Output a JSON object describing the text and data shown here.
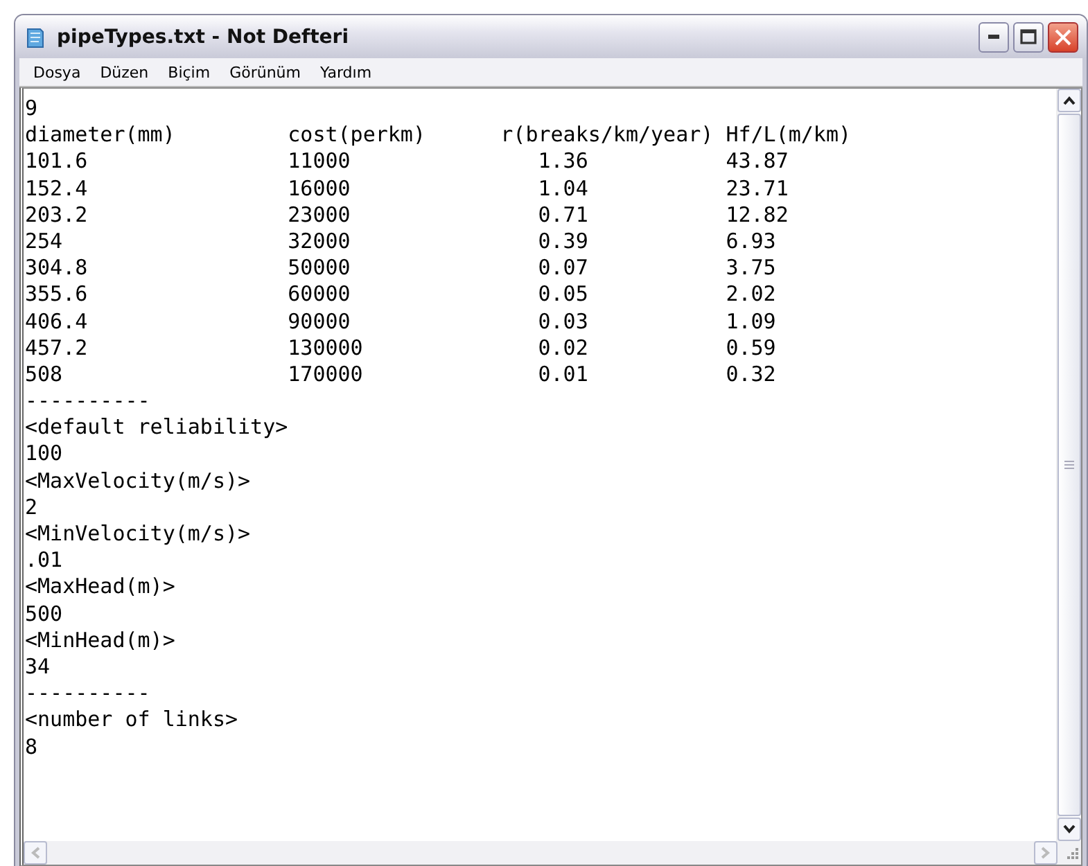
{
  "window": {
    "title": "pipeTypes.txt - Not Defteri"
  },
  "menu": [
    "Dosya",
    "Düzen",
    "Biçim",
    "Görünüm",
    "Yardım"
  ],
  "document": [
    {
      "kind": "text",
      "text": "9"
    },
    {
      "kind": "header",
      "cells": [
        "diameter(mm)",
        "cost(perkm)",
        "r(breaks/km/year)",
        "Hf/L(m/km)"
      ]
    },
    {
      "kind": "row",
      "cells": [
        "101.6",
        "11000",
        "1.36",
        "43.87"
      ]
    },
    {
      "kind": "row",
      "cells": [
        "152.4",
        "16000",
        "1.04",
        "23.71"
      ]
    },
    {
      "kind": "row",
      "cells": [
        "203.2",
        "23000",
        "0.71",
        "12.82"
      ]
    },
    {
      "kind": "row",
      "cells": [
        "254",
        "32000",
        "0.39",
        "6.93"
      ]
    },
    {
      "kind": "row",
      "cells": [
        "304.8",
        "50000",
        "0.07",
        "3.75"
      ]
    },
    {
      "kind": "row",
      "cells": [
        "355.6",
        "60000",
        "0.05",
        "2.02"
      ]
    },
    {
      "kind": "row",
      "cells": [
        "406.4",
        "90000",
        "0.03",
        "1.09"
      ]
    },
    {
      "kind": "row",
      "cells": [
        "457.2",
        "130000",
        "0.02",
        "0.59"
      ]
    },
    {
      "kind": "row",
      "cells": [
        "508",
        "170000",
        "0.01",
        "0.32"
      ]
    },
    {
      "kind": "text",
      "text": "----------"
    },
    {
      "kind": "text",
      "text": "<default reliability>"
    },
    {
      "kind": "text",
      "text": "100"
    },
    {
      "kind": "text",
      "text": "<MaxVelocity(m/s)>"
    },
    {
      "kind": "text",
      "text": "2"
    },
    {
      "kind": "text",
      "text": "<MinVelocity(m/s)>"
    },
    {
      "kind": "text",
      "text": ".01"
    },
    {
      "kind": "text",
      "text": "<MaxHead(m)>"
    },
    {
      "kind": "text",
      "text": "500"
    },
    {
      "kind": "text",
      "text": "<MinHead(m)>"
    },
    {
      "kind": "text",
      "text": "34"
    },
    {
      "kind": "text",
      "text": "----------"
    },
    {
      "kind": "text",
      "text": "<number of links>"
    },
    {
      "kind": "text",
      "text": "8"
    }
  ]
}
